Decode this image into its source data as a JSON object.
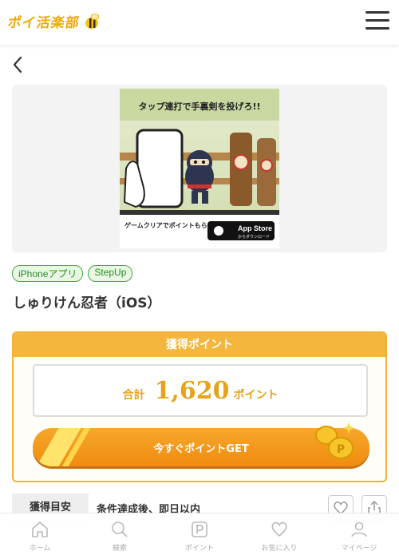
{
  "header": {
    "logo_text": "ポイ活楽部"
  },
  "banner": {
    "headline": "タップ連打で手裏剣を投げろ!!",
    "footer_text": "ゲームクリアでポイントもらえる?!",
    "store_badge_main": "App Store",
    "store_badge_sub": "からダウンロード"
  },
  "tags": [
    "iPhoneアプリ",
    "StepUp"
  ],
  "app_title": "しゅりけん忍者（iOS）",
  "points": {
    "header": "獲得ポイント",
    "total_label": "合計",
    "total_value": "1,620",
    "unit": "ポイント",
    "button_label": "今すぐポイントGET"
  },
  "info": {
    "label": "獲得目安",
    "value": "条件達成後、即日以内"
  },
  "nav": [
    {
      "label": "ホーム",
      "icon": "home-icon"
    },
    {
      "label": "検索",
      "icon": "search-icon"
    },
    {
      "label": "ポイント",
      "icon": "point-icon"
    },
    {
      "label": "お気に入り",
      "icon": "heart-icon"
    },
    {
      "label": "マイページ",
      "icon": "user-icon"
    }
  ],
  "colors": {
    "brand": "#f2a900",
    "accent_orange": "#f08c10",
    "tag_green": "#4aa84a"
  }
}
